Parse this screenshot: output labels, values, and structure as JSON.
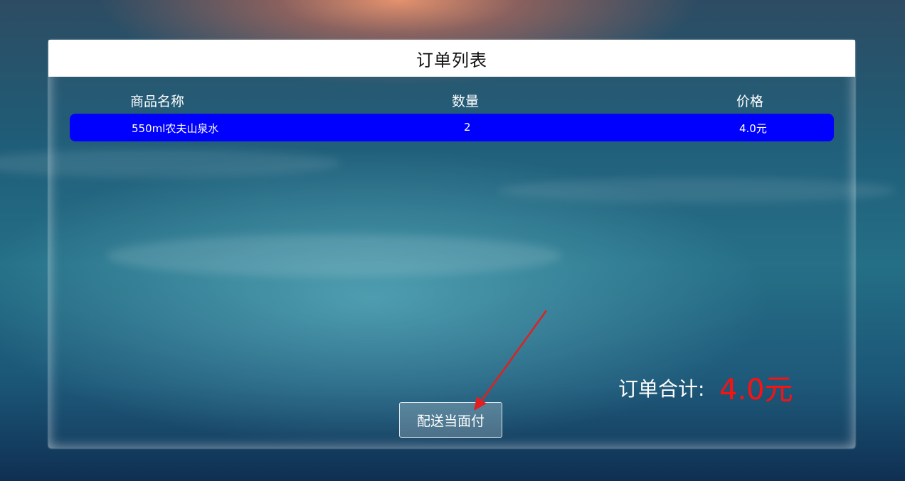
{
  "page": {
    "title": "订单列表"
  },
  "table": {
    "headers": [
      "商品名称",
      "数量",
      "价格"
    ],
    "rows": [
      {
        "name": "550ml农夫山泉水",
        "quantity": "2",
        "price": "4.0元"
      }
    ]
  },
  "summary": {
    "label": "订单合计:",
    "value": "4.0元"
  },
  "actions": {
    "pay_label": "配送当面付"
  },
  "colors": {
    "row_highlight": "#0000ff",
    "total_value": "#ff1010",
    "annotation_arrow": "#e02020"
  }
}
